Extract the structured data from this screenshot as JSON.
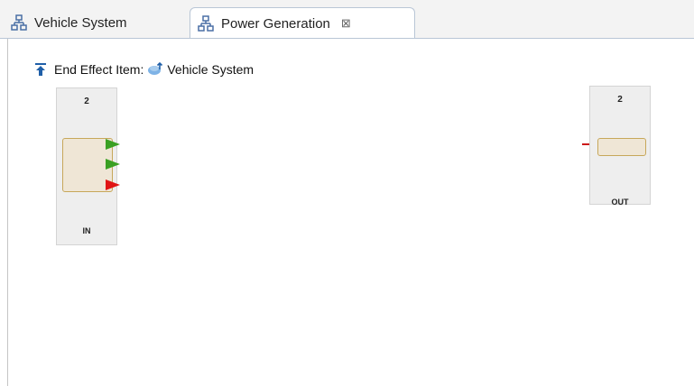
{
  "tabs": [
    {
      "label": "Vehicle System",
      "active": false
    },
    {
      "label": "Power Generation",
      "active": true,
      "close_glyph": "⊠"
    }
  ],
  "editor": {
    "end_effect_label": "End Effect Item:",
    "end_effect_value": "Vehicle System"
  },
  "blocks": {
    "in": {
      "number": "2",
      "label": "IN",
      "ports": [
        "green",
        "green",
        "red"
      ]
    },
    "out": {
      "number": "2",
      "label": "OUT",
      "ports": [
        "red"
      ]
    }
  },
  "colors": {
    "port_green": "#3aa023",
    "port_red": "#e01515",
    "block_fill": "#efe6d6",
    "block_border": "#c7a75a"
  }
}
